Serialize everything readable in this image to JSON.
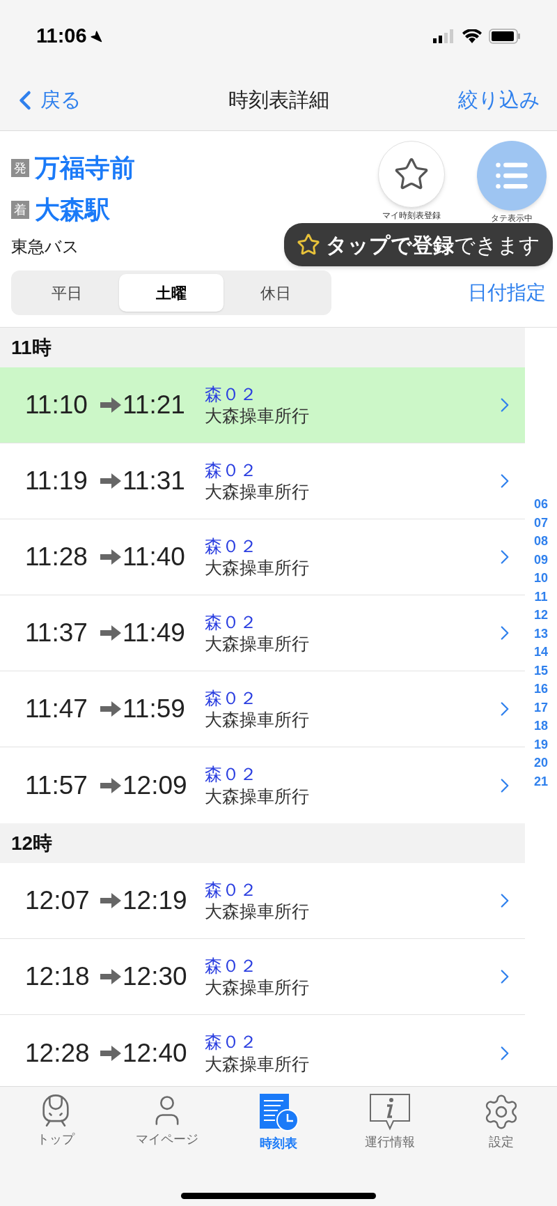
{
  "status_bar": {
    "time": "11:06"
  },
  "nav": {
    "back": "戻る",
    "title": "時刻表詳細",
    "action": "絞り込み"
  },
  "route": {
    "from_badge": "発",
    "from": "万福寺前",
    "to_badge": "着",
    "to": "大森駅",
    "operator": "東急バス"
  },
  "actions": [
    {
      "kind": "favorite",
      "label": "マイ時刻表登録"
    },
    {
      "kind": "list",
      "label": "タテ表示中",
      "on": true
    }
  ],
  "tooltip": {
    "bold": "タップで登録",
    "rest": "できます"
  },
  "day_tabs": [
    {
      "label": "平日",
      "selected": false
    },
    {
      "label": "土曜",
      "selected": true
    },
    {
      "label": "休日",
      "selected": false
    }
  ],
  "date_link": "日付指定",
  "sections": [
    {
      "title": "11時",
      "rows": [
        {
          "depart": "11:10",
          "arrive": "11:21",
          "route": "森０２",
          "destination": "大森操車所行",
          "highlighted": true
        },
        {
          "depart": "11:19",
          "arrive": "11:31",
          "route": "森０２",
          "destination": "大森操車所行",
          "highlighted": false
        },
        {
          "depart": "11:28",
          "arrive": "11:40",
          "route": "森０２",
          "destination": "大森操車所行",
          "highlighted": false
        },
        {
          "depart": "11:37",
          "arrive": "11:49",
          "route": "森０２",
          "destination": "大森操車所行",
          "highlighted": false
        },
        {
          "depart": "11:47",
          "arrive": "11:59",
          "route": "森０２",
          "destination": "大森操車所行",
          "highlighted": false
        },
        {
          "depart": "11:57",
          "arrive": "12:09",
          "route": "森０２",
          "destination": "大森操車所行",
          "highlighted": false
        }
      ]
    },
    {
      "title": "12時",
      "rows": [
        {
          "depart": "12:07",
          "arrive": "12:19",
          "route": "森０２",
          "destination": "大森操車所行",
          "highlighted": false
        },
        {
          "depart": "12:18",
          "arrive": "12:30",
          "route": "森０２",
          "destination": "大森操車所行",
          "highlighted": false
        },
        {
          "depart": "12:28",
          "arrive": "12:40",
          "route": "森０２",
          "destination": "大森操車所行",
          "highlighted": false
        }
      ]
    }
  ],
  "hour_index": [
    "06",
    "07",
    "08",
    "09",
    "10",
    "11",
    "12",
    "13",
    "14",
    "15",
    "16",
    "17",
    "18",
    "19",
    "20",
    "21"
  ],
  "tab_bar": [
    {
      "kind": "train",
      "label": "トップ",
      "selected": false
    },
    {
      "kind": "person",
      "label": "マイページ",
      "selected": false
    },
    {
      "kind": "timetable",
      "label": "時刻表",
      "selected": true
    },
    {
      "kind": "info",
      "label": "運行情報",
      "selected": false
    },
    {
      "kind": "settings",
      "label": "設定",
      "selected": false
    }
  ]
}
